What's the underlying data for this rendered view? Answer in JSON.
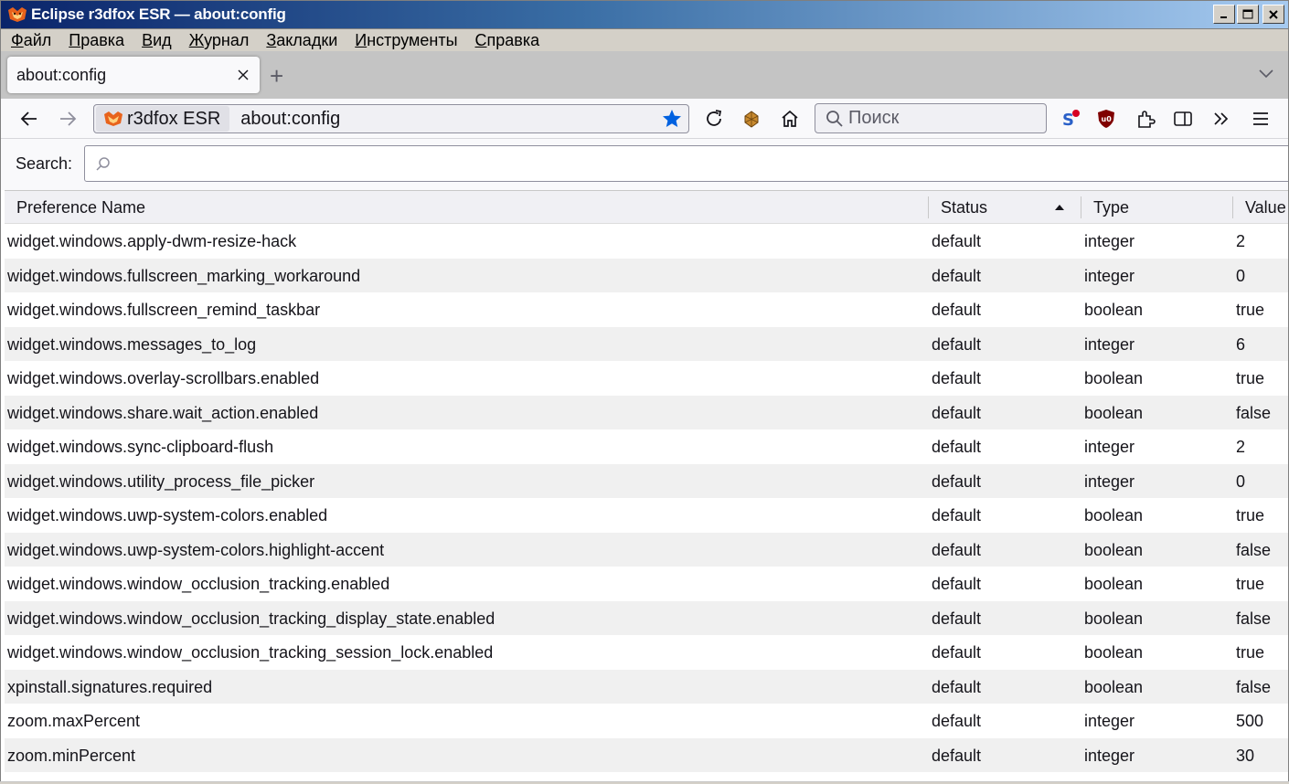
{
  "window": {
    "title": "Eclipse r3dfox ESR — about:config",
    "controls": {
      "minimize": "_",
      "maximize": "□",
      "close": "✕"
    }
  },
  "menu": [
    {
      "label": "Файл",
      "key": "Ф",
      "rest": "айл"
    },
    {
      "label": "Правка",
      "key": "П",
      "rest": "равка"
    },
    {
      "label": "Вид",
      "key": "В",
      "rest": "ид"
    },
    {
      "label": "Журнал",
      "key": "Ж",
      "rest": "урнал"
    },
    {
      "label": "Закладки",
      "key": "З",
      "rest": "акладки"
    },
    {
      "label": "Инструменты",
      "key": "И",
      "rest": "нструменты"
    },
    {
      "label": "Справка",
      "key": "С",
      "rest": "правка"
    }
  ],
  "tabs": [
    {
      "label": "about:config",
      "close": "✕"
    }
  ],
  "new_tab": "+",
  "navbar": {
    "identity_label": "r3dfox ESR",
    "url": "about:config",
    "search_placeholder": "Поиск"
  },
  "config": {
    "search_label": "Search:",
    "columns": {
      "name": "Preference Name",
      "status": "Status",
      "type": "Type",
      "value": "Value"
    },
    "sort": {
      "column": "status",
      "direction": "ascending"
    },
    "rows": [
      {
        "name": "widget.windows.apply-dwm-resize-hack",
        "status": "default",
        "type": "integer",
        "value": "2"
      },
      {
        "name": "widget.windows.fullscreen_marking_workaround",
        "status": "default",
        "type": "integer",
        "value": "0"
      },
      {
        "name": "widget.windows.fullscreen_remind_taskbar",
        "status": "default",
        "type": "boolean",
        "value": "true"
      },
      {
        "name": "widget.windows.messages_to_log",
        "status": "default",
        "type": "integer",
        "value": "6"
      },
      {
        "name": "widget.windows.overlay-scrollbars.enabled",
        "status": "default",
        "type": "boolean",
        "value": "true"
      },
      {
        "name": "widget.windows.share.wait_action.enabled",
        "status": "default",
        "type": "boolean",
        "value": "false"
      },
      {
        "name": "widget.windows.sync-clipboard-flush",
        "status": "default",
        "type": "integer",
        "value": "2"
      },
      {
        "name": "widget.windows.utility_process_file_picker",
        "status": "default",
        "type": "integer",
        "value": "0"
      },
      {
        "name": "widget.windows.uwp-system-colors.enabled",
        "status": "default",
        "type": "boolean",
        "value": "true"
      },
      {
        "name": "widget.windows.uwp-system-colors.highlight-accent",
        "status": "default",
        "type": "boolean",
        "value": "false"
      },
      {
        "name": "widget.windows.window_occlusion_tracking.enabled",
        "status": "default",
        "type": "boolean",
        "value": "true"
      },
      {
        "name": "widget.windows.window_occlusion_tracking_display_state.enabled",
        "status": "default",
        "type": "boolean",
        "value": "false"
      },
      {
        "name": "widget.windows.window_occlusion_tracking_session_lock.enabled",
        "status": "default",
        "type": "boolean",
        "value": "true"
      },
      {
        "name": "xpinstall.signatures.required",
        "status": "default",
        "type": "boolean",
        "value": "false"
      },
      {
        "name": "zoom.maxPercent",
        "status": "default",
        "type": "integer",
        "value": "500"
      },
      {
        "name": "zoom.minPercent",
        "status": "default",
        "type": "integer",
        "value": "30"
      }
    ]
  },
  "colors": {
    "bookmark_star": "#0061e0",
    "titlebar_start": "#0a246a",
    "titlebar_end": "#a6caf0",
    "ublock_red": "#800000"
  },
  "icons": [
    "back-icon",
    "forward-icon",
    "reload-icon",
    "extension-puzzle-icon",
    "home-icon",
    "search-icon",
    "sync-icon",
    "ublock-icon",
    "sidebar-icon",
    "overflow-icon",
    "hamburger-menu-icon",
    "bookmark-star-icon",
    "tab-list-chevron-icon"
  ]
}
